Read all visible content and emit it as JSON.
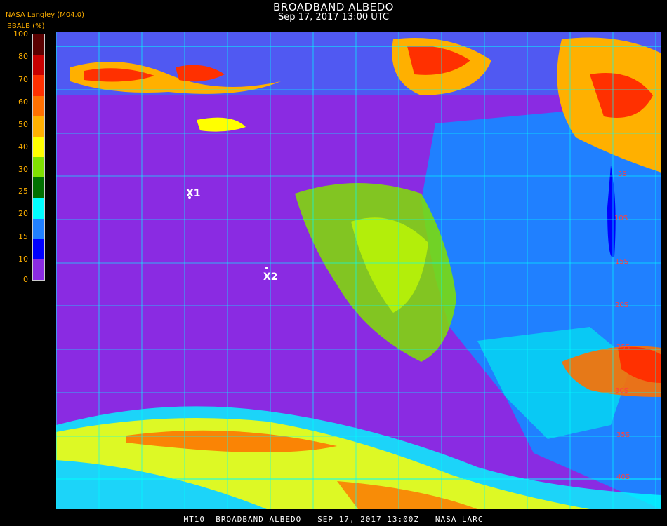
{
  "title": "BROADBAND ALBEDO",
  "subtitle": "Sep 17, 2017 13:00 UTC",
  "source": "NASA Langley (M04.0)",
  "colorbar": {
    "label": "BBALB (%)",
    "ticks": [
      "100",
      "80",
      "70",
      "60",
      "50",
      "40",
      "30",
      "25",
      "20",
      "15",
      "10",
      "0"
    ],
    "colors": [
      "#5a0000",
      "#c80000",
      "#ff3000",
      "#ff7000",
      "#ffb000",
      "#ffff00",
      "#80e000",
      "#007000",
      "#00ffff",
      "#2080ff",
      "#0000ff",
      "#8a2be2"
    ]
  },
  "markers": [
    {
      "id": "x1",
      "label": "X1"
    },
    {
      "id": "x2",
      "label": "X2"
    }
  ],
  "lat_labels": [
    "5S",
    "10S",
    "15S",
    "20S",
    "25S",
    "30S",
    "35S",
    "40S"
  ],
  "footer": "MT10  BROADBAND ALBEDO   SEP 17, 2017 13:00Z   NASA LARC",
  "colors": {
    "ocean_clear": "#8a2be2",
    "land_clear": "#2080ff",
    "grid": "#00ffff",
    "marker": "#ffffff",
    "lat_label": "#ff4040",
    "text_accent": "#ffb000"
  }
}
